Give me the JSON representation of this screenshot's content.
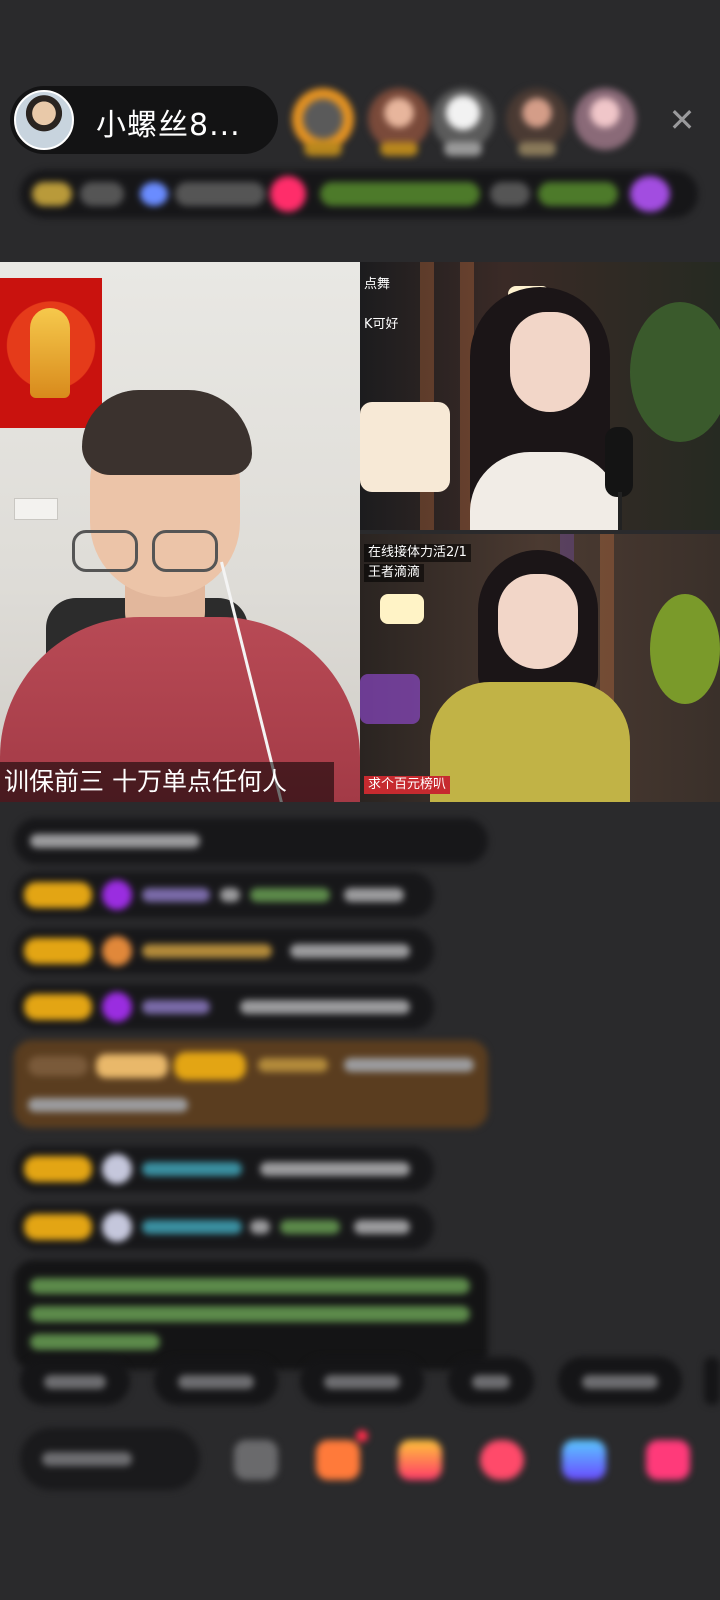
{
  "header": {
    "host_name": "小螺丝8...",
    "close_icon": "close-icon",
    "viewer_avatars": [
      "viewer-1",
      "viewer-2",
      "viewer-3",
      "viewer-4",
      "viewer-5"
    ]
  },
  "video": {
    "host_caption": "训保前三  十万单点任何人",
    "guest1": {
      "tag_line_1": "点舞",
      "tag_line_2": "K可好"
    },
    "guest2": {
      "tag_line_1": "在线接体力活2/1",
      "tag_line_2": "王者滴滴",
      "bottom_tag": "求个百元榜叭"
    }
  },
  "colors": {
    "background": "#2a2a2c",
    "accent_gold": "#e3a514",
    "accent_red": "#c62a2f"
  }
}
